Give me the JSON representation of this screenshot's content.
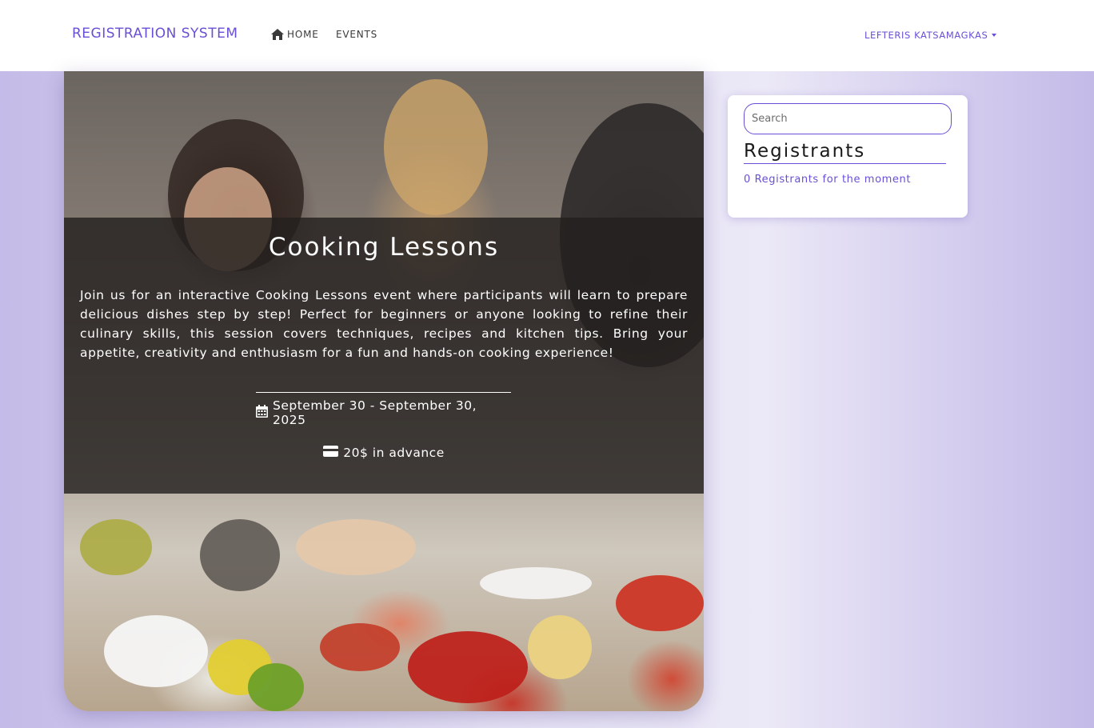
{
  "navbar": {
    "brand": "REGISTRATION SYSTEM",
    "home_label": "HOME",
    "events_label": "EVENTS",
    "user_name": "LEFTERIS KATSAMAGKAS",
    "home_icon": "home-icon",
    "user_icon": "caret-down-icon"
  },
  "event": {
    "title": "Cooking Lessons",
    "description": "Join us for an interactive Cooking Lessons event where participants will learn to prepare delicious dishes step by step! Perfect for beginners or anyone looking to refine their culinary skills, this session covers techniques, recipes and kitchen tips. Bring your appetite, creativity and enthusiasm for a fun and hands-on cooking experience!",
    "dates": "September 30 - September 30, 2025",
    "price": "20$ in advance",
    "date_icon": "calendar-icon",
    "price_icon": "credit-card-icon"
  },
  "sidebar": {
    "search_placeholder": "Search",
    "registrants_title": "Registrants",
    "registrants_count": "0 Registrants for the moment"
  },
  "colors": {
    "accent": "#6a4fd6",
    "overlay": "#23201e",
    "background": "#c4bbe8"
  }
}
